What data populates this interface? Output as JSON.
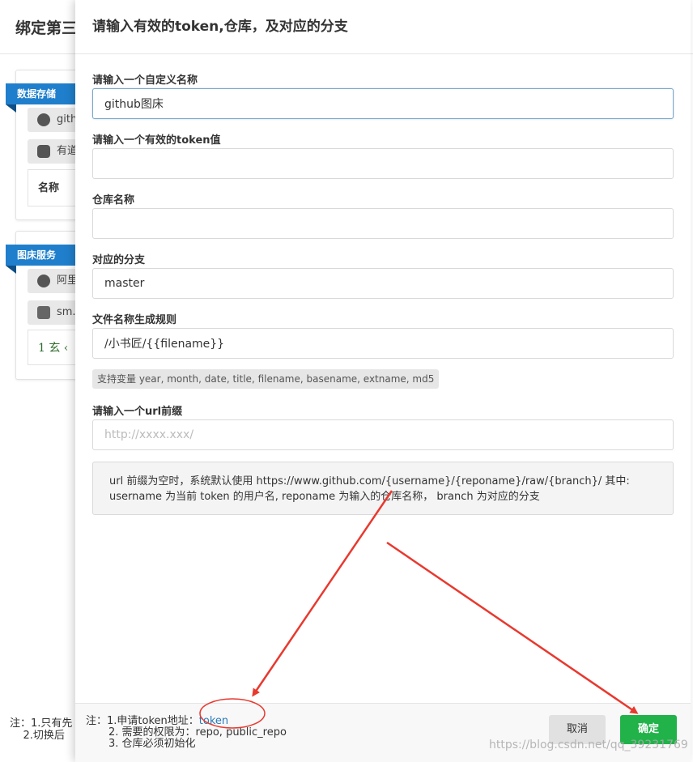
{
  "background": {
    "title": "绑定第三",
    "sections": [
      {
        "label": "数据存储",
        "items": [
          {
            "label": "gith",
            "icon": "github-icon"
          },
          {
            "label": "有道",
            "icon": "youdao-icon"
          }
        ],
        "name_label": "名称"
      },
      {
        "label": "图床服务",
        "items": [
          {
            "label": "阿里",
            "icon": "aliyun-icon"
          },
          {
            "label": "sm.",
            "icon": "hand-icon"
          }
        ],
        "script_text": "1 玄 ‹"
      }
    ],
    "note": "注：1.只有先\n    2.切换后"
  },
  "modal": {
    "title": "请输入有效的token,仓库，及对应的分支",
    "fields": [
      {
        "label": "请输入一个自定义名称",
        "value": "github图床",
        "placeholder": ""
      },
      {
        "label": "请输入一个有效的token值",
        "value": "",
        "placeholder": ""
      },
      {
        "label": "仓库名称",
        "value": "",
        "placeholder": ""
      },
      {
        "label": "对应的分支",
        "value": "master",
        "placeholder": ""
      },
      {
        "label": "文件名称生成规则",
        "value": "/小书匠/{{filename}}",
        "placeholder": ""
      },
      {
        "label": "请输入一个url前缀",
        "value": "",
        "placeholder": "http://xxxx.xxx/"
      }
    ],
    "variables_hint": "支持变量 year, month, date, title, filename, basename, extname, md5",
    "url_description": "url 前缀为空时，系统默认使用 https://www.github.com/{username}/{reponame}/raw/{branch}/ 其中: username 为当前 token 的用户名, reponame 为输入的仓库名称， branch 为对应的分支",
    "footer": {
      "note_prefix": "注：1.申请token地址：",
      "token_link": "token",
      "note_line2": "2. 需要的权限为：repo, public_repo",
      "note_line3": "3. 仓库必须初始化",
      "cancel_label": "取消",
      "ok_label": "确定"
    }
  },
  "watermark": "https://blog.csdn.net/qq_39231769",
  "colors": {
    "primary": "#21b24a",
    "ribbon": "#1f7fcc",
    "link": "#2a7ab8",
    "annotation": "#e8392f"
  }
}
